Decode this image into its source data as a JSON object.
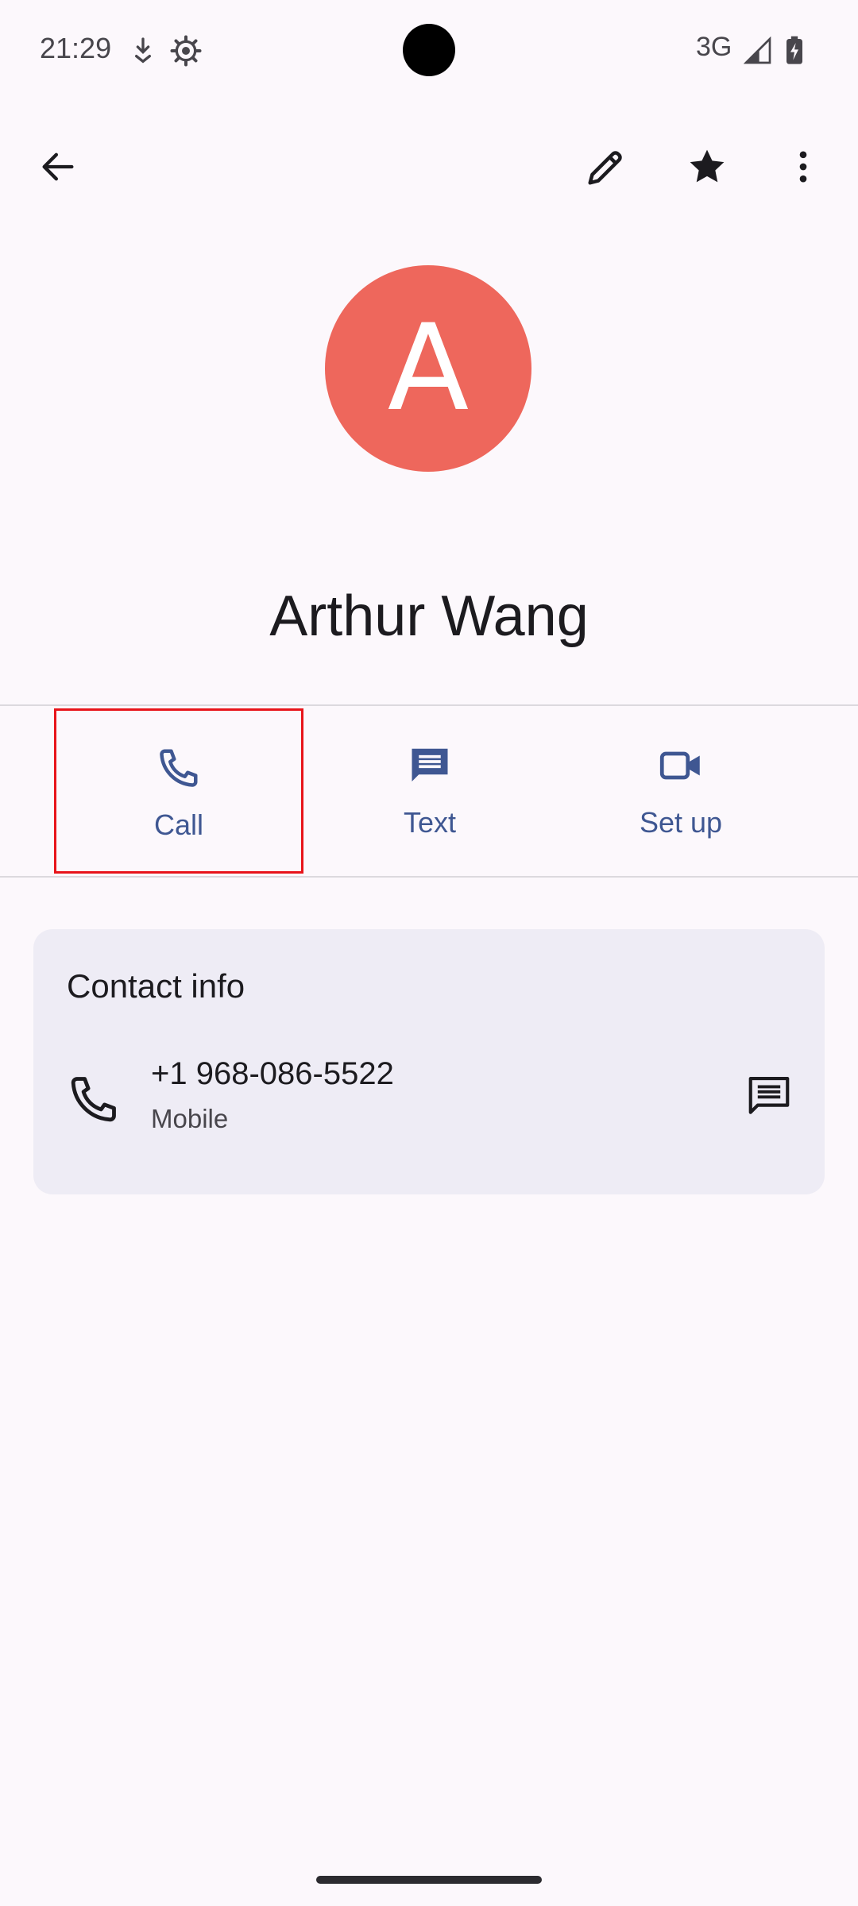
{
  "status_bar": {
    "time": "21:29",
    "network": "3G",
    "icons": [
      "download-arrow-icon",
      "settings-gear-icon",
      "signal-icon",
      "battery-charging-icon"
    ]
  },
  "top_bar": {
    "icons": [
      "back-arrow-icon",
      "edit-pencil-icon",
      "star-icon",
      "more-vert-icon"
    ]
  },
  "contact": {
    "initial": "A",
    "name": "Arthur Wang",
    "avatar_color": "#ee675c"
  },
  "actions": [
    {
      "label": "Call",
      "icon": "phone-icon"
    },
    {
      "label": "Text",
      "icon": "message-icon"
    },
    {
      "label": "Set up",
      "icon": "video-camera-icon"
    }
  ],
  "contact_info": {
    "title": "Contact info",
    "phone_number": "+1 968-086-5522",
    "phone_type": "Mobile",
    "icons": [
      "phone-icon",
      "message-icon"
    ]
  },
  "colors": {
    "background": "#fcf8fc",
    "accent": "#3f5792",
    "card": "#eeecf5",
    "highlight": "#e8141a"
  }
}
